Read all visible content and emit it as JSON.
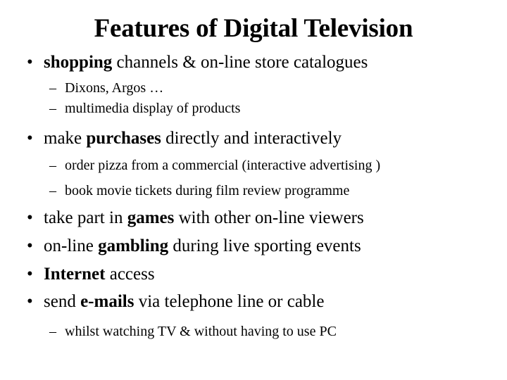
{
  "slide": {
    "title": "Features of Digital Television",
    "background_color": "#ffffff",
    "text_color": "#000000",
    "bullet_marker": "•",
    "subbullet_marker": "–",
    "items": [
      {
        "level": 1,
        "marker": "•",
        "bold_part": "shopping",
        "rest": " channels & on-line store catalogues"
      },
      {
        "level": 2,
        "marker": "–",
        "text": "Dixons, Argos …"
      },
      {
        "level": 2,
        "marker": "–",
        "text": "multimedia display of products"
      },
      {
        "level": 1,
        "marker": "•",
        "pre": "make ",
        "bold_part": "purchases",
        "rest": " directly and interactively"
      },
      {
        "level": 2,
        "marker": "–",
        "text": "order pizza from a commercial (interactive advertising )"
      },
      {
        "level": 2,
        "marker": "–",
        "text": "book movie tickets during film review programme"
      },
      {
        "level": 1,
        "marker": "•",
        "pre": "take part in ",
        "bold_part": "games",
        "rest": " with other on-line viewers"
      },
      {
        "level": 1,
        "marker": "•",
        "pre": "on-line ",
        "bold_part": "gambling",
        "rest": " during live sporting events"
      },
      {
        "level": 1,
        "marker": "•",
        "bold_part": "Internet",
        "rest": " access"
      },
      {
        "level": 1,
        "marker": "•",
        "pre": "send ",
        "bold_part": "e-mails",
        "rest": " via telephone line or cable"
      },
      {
        "level": 2,
        "marker": "–",
        "text": "whilst watching TV & without having to use PC"
      }
    ]
  }
}
